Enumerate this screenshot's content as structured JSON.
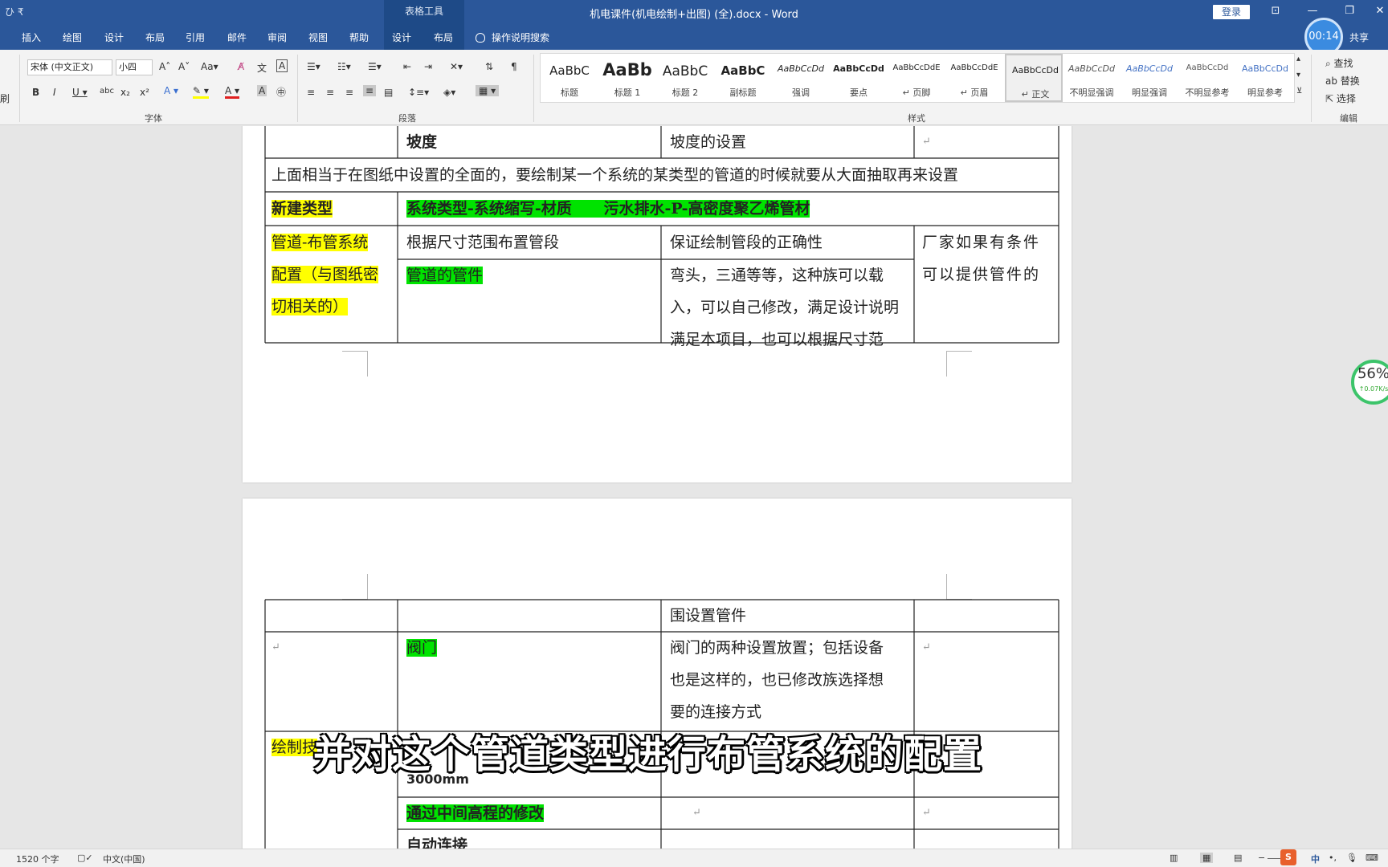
{
  "titlebar": {
    "contextual_tab": "表格工具",
    "document_title": "机电课件(机电绘制+出图) (全).docx  -  Word",
    "login": "登录",
    "qat": "ひ  ₹"
  },
  "tabs": [
    "插入",
    "绘图",
    "设计",
    "布局",
    "引用",
    "邮件",
    "审阅",
    "视图",
    "帮助",
    "设计",
    "布局"
  ],
  "tell_me": "操作说明搜索",
  "share": "共享",
  "timer": "00:14",
  "ribbon": {
    "font_name": "宋体 (中文正文)",
    "font_size": "小四",
    "group_font": "字体",
    "group_paragraph": "段落",
    "group_styles": "样式",
    "group_edit": "编辑",
    "clipboard_fragment": "刷",
    "styles": [
      {
        "sample": "AaBbC",
        "name": "标题"
      },
      {
        "sample": "AaBb",
        "name": "标题 1"
      },
      {
        "sample": "AaBbC",
        "name": "标题 2"
      },
      {
        "sample": "AaBbC",
        "name": "副标题"
      },
      {
        "sample": "AaBbCcDd",
        "name": "强调"
      },
      {
        "sample": "AaBbCcDd",
        "name": "要点"
      },
      {
        "sample": "AaBbCcDdE",
        "name": "↵ 页脚"
      },
      {
        "sample": "AaBbCcDdE",
        "name": "↵ 页眉"
      },
      {
        "sample": "AaBbCcDd",
        "name": "↵ 正文"
      },
      {
        "sample": "AaBbCcDd",
        "name": "不明显强调"
      },
      {
        "sample": "AaBbCcDd",
        "name": "明显强调"
      },
      {
        "sample": "AaBbCcDd",
        "name": "不明显参考"
      },
      {
        "sample": "AaBbCcDd",
        "name": "明显参考"
      }
    ],
    "find": "查找",
    "replace": "替换",
    "select": "选择"
  },
  "doc": {
    "page1": {
      "r1_c2": "坡度",
      "r1_c3": "坡度的设置",
      "r2_full": "上面相当于在图纸中设置的全面的，要绘制某一个系统的某类型的管道的时候就要从大面抽取再来设置",
      "r3_c1": "新建类型",
      "r3_c2": "系统类型-系统缩写-材质      污水排水-P-高密度聚乙烯管材",
      "r4_c1_l1": "管道-布管系统",
      "r4_c1_l2": "配置（与图纸密",
      "r4_c1_l3": "切相关的）",
      "r4_c2": "根据尺寸范围布置管段",
      "r4_c3": "保证绘制管段的正确性",
      "r4_c4_l1": "厂家如果有条件",
      "r4_c4_l2": "可以提供管件的",
      "r5_c2": "管道的管件",
      "r5_c3_l1": "弯头，三通等等，这种族可以载",
      "r5_c3_l2": "入，可以自己修改，满足设计说明",
      "r5_c3_l3": "满足本项目，也可以根据尺寸范"
    },
    "page2": {
      "r1_c3": "围设置管件",
      "r2_c2": "阀门",
      "r2_c3_l1": "阀门的两种设置放置；包括设备",
      "r2_c3_l2": "也是这样的，也已修改族选择想",
      "r2_c3_l3": "要的连接方式",
      "r3_c1": "绘制技",
      "r3_c2": "3000mm",
      "r4_c2": "通过中间高程的修改",
      "r5_c2": "自动连接"
    }
  },
  "subtitle": "并对这个管道类型进行布管系统的配置",
  "status": {
    "word_count": "1520 个字",
    "language": "中文(中国)",
    "ime": "中"
  },
  "speed": {
    "pct": "56%",
    "rate": "↑0.07K/s"
  }
}
